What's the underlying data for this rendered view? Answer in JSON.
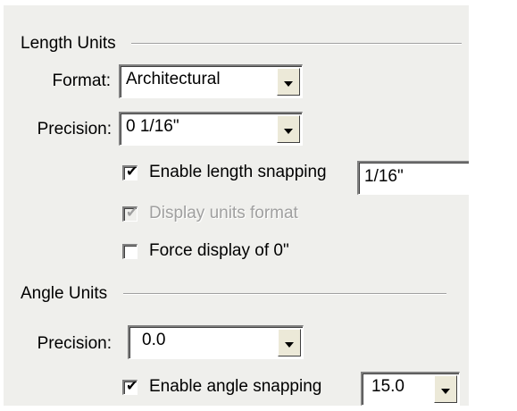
{
  "length_units": {
    "title": "Length Units",
    "format_label": "Format:",
    "format_value": "Architectural",
    "precision_label": "Precision:",
    "precision_value": "0 1/16\"",
    "enable_snapping_label": "Enable length snapping",
    "enable_snapping_checked": true,
    "snapping_value": "1/16\"",
    "display_units_label": "Display units format",
    "display_units_checked": true,
    "display_units_enabled": false,
    "force_display_label": "Force display of 0\"",
    "force_display_checked": false
  },
  "angle_units": {
    "title": "Angle Units",
    "precision_label": "Precision:",
    "precision_value": "0.0",
    "enable_snapping_label": "Enable angle snapping",
    "enable_snapping_checked": true,
    "snapping_value": "15.0"
  },
  "icons": {
    "check": "✔",
    "dropdown": "chevron-down-icon"
  },
  "colors": {
    "panel_bg": "#efefec",
    "disabled_text": "#a0a0a0"
  }
}
